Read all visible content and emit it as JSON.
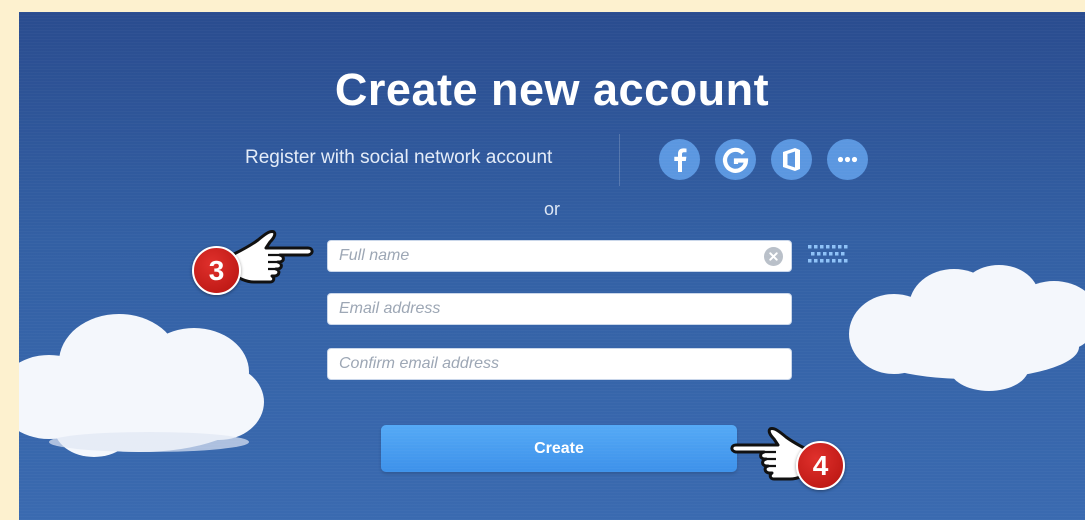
{
  "title": "Create new account",
  "social": {
    "prompt": "Register with social network account",
    "providers": [
      "facebook-icon",
      "google-icon",
      "office-icon",
      "more-icon"
    ]
  },
  "separator": "or",
  "form": {
    "full_name": {
      "placeholder": "Full name",
      "value": ""
    },
    "email": {
      "placeholder": "Email address",
      "value": ""
    },
    "confirm_email": {
      "placeholder": "Confirm email address",
      "value": ""
    },
    "create_label": "Create"
  },
  "annotations": {
    "step_3": "3",
    "step_4": "4"
  },
  "colors": {
    "panel": "#3360a4",
    "background": "#fdf1cf",
    "button": "#4a9ef0",
    "social": "#5b97e0",
    "badge": "#c91c18"
  }
}
